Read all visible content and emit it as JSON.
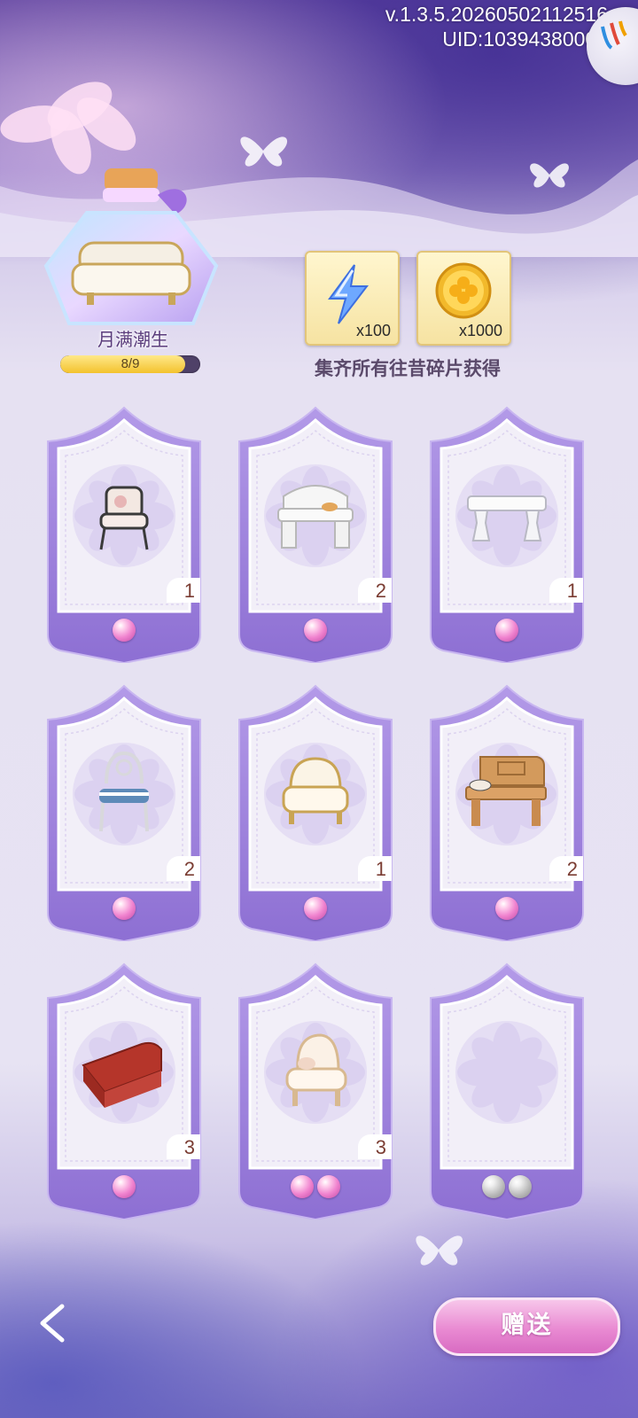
{
  "header": {
    "version": "v.1.3.5.20260502112516",
    "uid": "UID:10394380006"
  },
  "set": {
    "name": "月满潮生",
    "progress_text": "8/9",
    "progress_fraction": 0.889
  },
  "rewards": [
    {
      "icon": "energy-bolt-icon",
      "qty": "x100"
    },
    {
      "icon": "gold-clover-coin-icon",
      "qty": "x1000"
    }
  ],
  "reward_caption": "集齐所有往昔碎片获得",
  "cards": [
    {
      "item": "garden-armchair",
      "count": "1",
      "gems": [
        "pink"
      ]
    },
    {
      "item": "white-carved-bench",
      "count": "2",
      "gems": [
        "pink"
      ]
    },
    {
      "item": "marble-bench",
      "count": "1",
      "gems": [
        "pink"
      ]
    },
    {
      "item": "wire-chair-striped-cushion",
      "count": "2",
      "gems": [
        "pink"
      ]
    },
    {
      "item": "gold-baroque-armchair",
      "count": "1",
      "gems": [
        "pink"
      ]
    },
    {
      "item": "wooden-bench-with-cat",
      "count": "2",
      "gems": [
        "pink"
      ]
    },
    {
      "item": "red-sofa",
      "count": "3",
      "gems": [
        "pink"
      ]
    },
    {
      "item": "cream-armchair",
      "count": "3",
      "gems": [
        "pink",
        "pink"
      ]
    },
    {
      "item": "empty-slot",
      "count": "",
      "gems": [
        "silver",
        "silver"
      ]
    }
  ],
  "footer": {
    "gift_label": "赠送",
    "back_icon": "back-arrow-icon"
  },
  "colors": {
    "accent_purple": "#9b7fd6",
    "gift_pink": "#e98ad2",
    "count_text": "#7b3d33"
  }
}
